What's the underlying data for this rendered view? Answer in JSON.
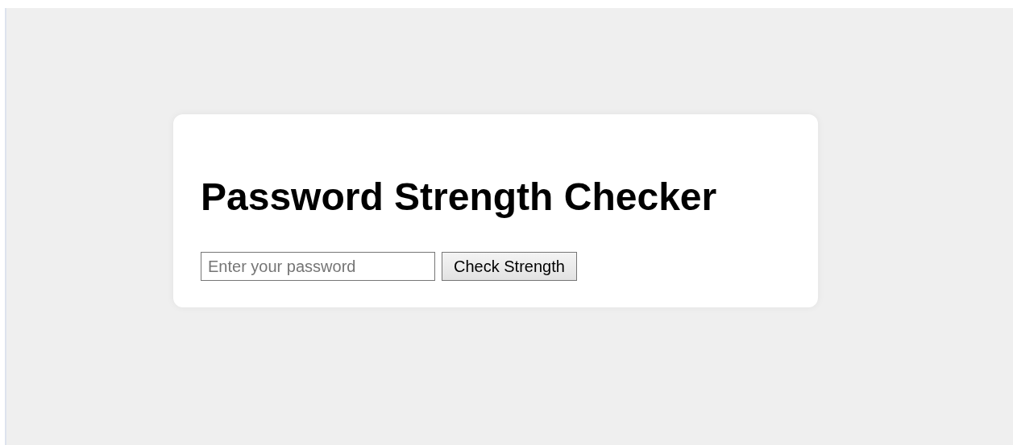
{
  "title": "Password Strength Checker",
  "password_field": {
    "placeholder": "Enter your password"
  },
  "check_button": {
    "label": "Check Strength"
  }
}
